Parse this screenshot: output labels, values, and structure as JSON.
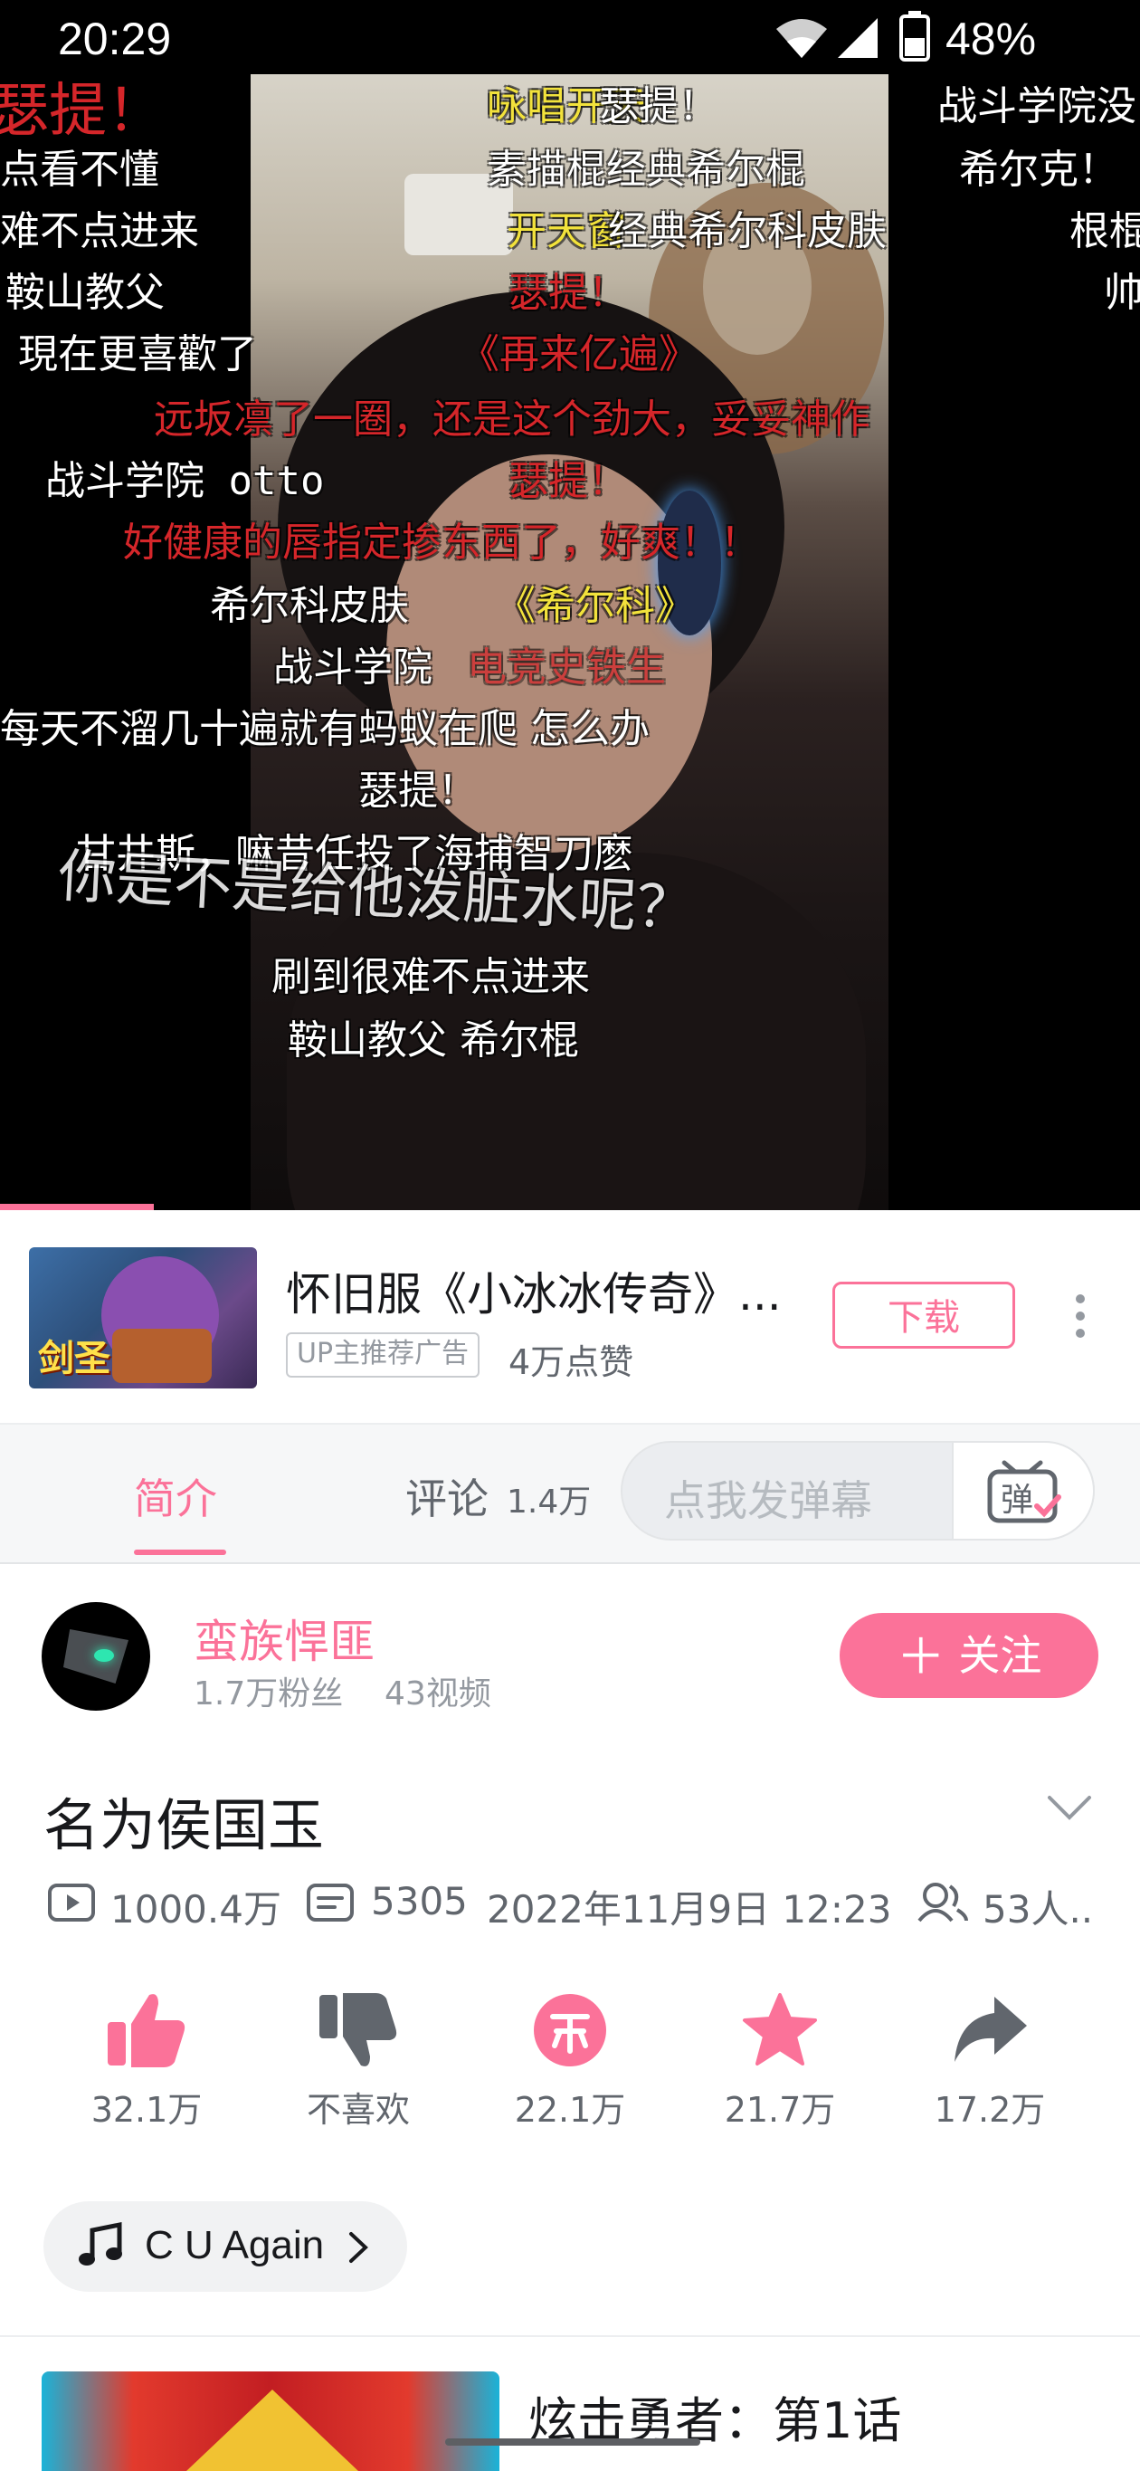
{
  "status_bar": {
    "time": "20:29",
    "battery": "48%"
  },
  "danmaku": [
    "瑟提！",
    "点看不懂",
    "难不点进来",
    "鞍山教父",
    "現在更喜歡了",
    "远坂凛了一圈，还是这个劲大，妥妥神作",
    "战斗学院 otto",
    "好健康的唇指定掺东西了，好爽！！",
    "希尔科皮肤",
    "《希尔科》",
    "战斗学院",
    "电竞史铁生",
    "每天不溜几十遍就有蚂蚁在爬 怎么办",
    "瑟提！",
    "甘井斯，嘛昔任投了海捕智刀麽",
    "你是不是给他泼脏水呢？",
    "刷到很难不点进来",
    "鞍山教父 希尔棍",
    "咏唱开天",
    "瑟提！",
    "素描棍经典希尔棍",
    "开天窗",
    "经典希尔科皮肤",
    "瑟提！",
    "《再来亿遍》",
    "瑟提！",
    "战斗学院没",
    "希尔克！",
    "根棍",
    "帅"
  ],
  "ad": {
    "thumb_text": "剑圣",
    "title": "怀旧服《小冰冰传奇》...",
    "badge": "UP主推荐广告",
    "likes": "4万点赞",
    "download_label": "下载"
  },
  "tabs": {
    "intro": "简介",
    "comments": "评论",
    "comments_count": "1.4万",
    "danmaku_placeholder": "点我发弹幕",
    "danmaku_toggle_glyph": "弹"
  },
  "uploader": {
    "name": "蛮族悍匪",
    "fans": "1.7万粉丝",
    "videos": "43视频",
    "follow_label": "关注"
  },
  "video": {
    "title": "名为侯国玉",
    "views": "1000.4万",
    "danmaku_count": "5305",
    "date": "2022年11月9日 12:23",
    "watching": "53人.."
  },
  "actions": [
    {
      "id": "like",
      "label": "32.1万",
      "icon": "thumbs-up-icon",
      "color": "#fb7299"
    },
    {
      "id": "dislike",
      "label": "不喜欢",
      "icon": "thumbs-down-icon",
      "color": "#61666d"
    },
    {
      "id": "coin",
      "label": "22.1万",
      "icon": "coin-icon",
      "color": "#fb7299"
    },
    {
      "id": "favorite",
      "label": "21.7万",
      "icon": "star-icon",
      "color": "#fb7299"
    },
    {
      "id": "share",
      "label": "17.2万",
      "icon": "share-icon",
      "color": "#61666d"
    }
  ],
  "music": {
    "label": "C U Again"
  },
  "recommendation": {
    "title": "炫击勇者：第1话"
  },
  "colors": {
    "accent": "#fb7299",
    "text": "#18191c",
    "muted": "#61666d"
  }
}
